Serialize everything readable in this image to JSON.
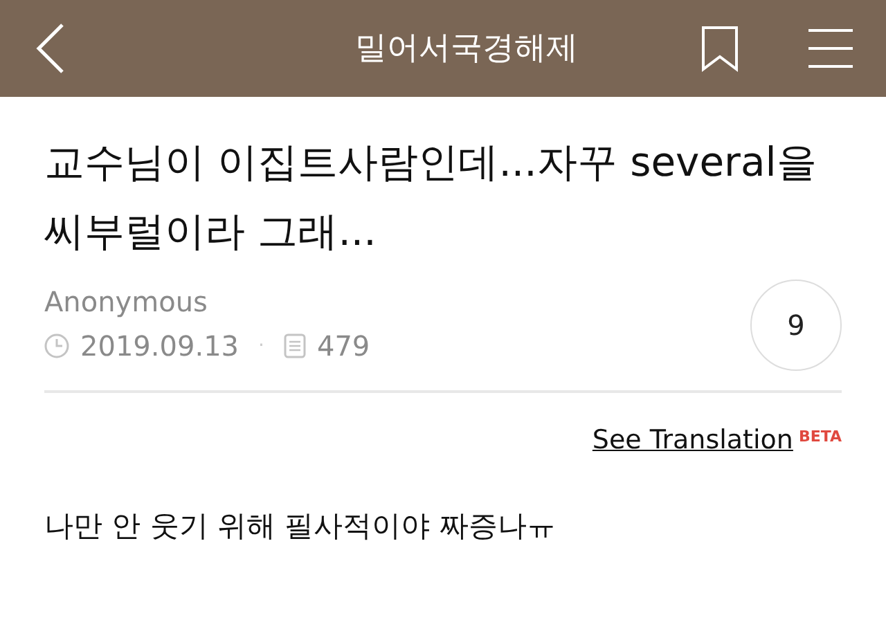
{
  "header": {
    "title": "밀어서국경해제"
  },
  "post": {
    "title": "교수님이 이집트사람인데...자꾸 several을 씨부럴이라 그래...",
    "author": "Anonymous",
    "date": "2019.09.13",
    "separator": "·",
    "views": "479",
    "comment_count": "9"
  },
  "translation": {
    "link": "See Translation",
    "badge": "BETA"
  },
  "body": "나만 안 웃기 위해 필사적이야 짜증나ㅠ"
}
